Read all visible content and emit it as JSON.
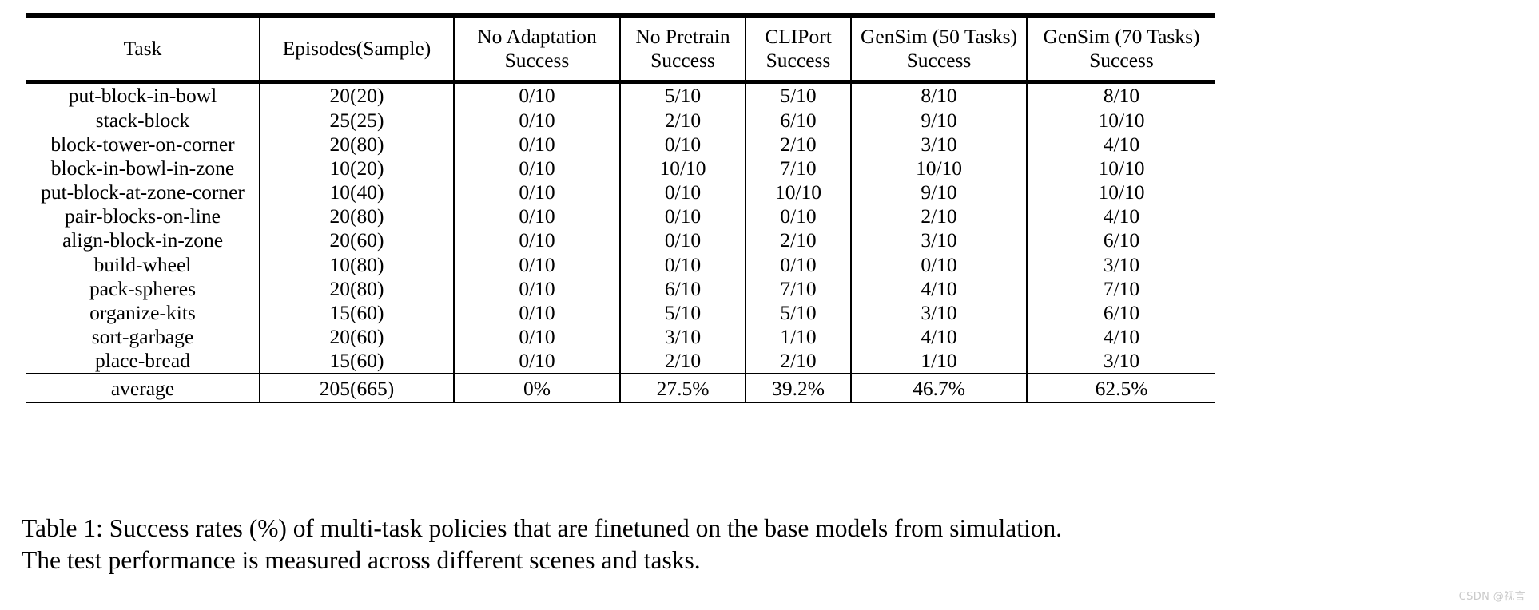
{
  "table": {
    "id": "table-1",
    "columns": [
      {
        "key": "task",
        "line1": "Task",
        "line2": ""
      },
      {
        "key": "ep",
        "line1": "Episodes(Sample)",
        "line2": ""
      },
      {
        "key": "noadapt",
        "line1": "No Adaptation",
        "line2": "Success"
      },
      {
        "key": "nopre",
        "line1": "No Pretrain",
        "line2": "Success"
      },
      {
        "key": "clip",
        "line1": "CLIPort",
        "line2": "Success"
      },
      {
        "key": "g50",
        "line1": "GenSim (50 Tasks)",
        "line2": "Success"
      },
      {
        "key": "g70",
        "line1": "GenSim (70 Tasks)",
        "line2": "Success"
      }
    ],
    "rows": [
      {
        "task": "put-block-in-bowl",
        "ep": "20(20)",
        "noadapt": "0/10",
        "nopre": "5/10",
        "clip": "5/10",
        "g50": "8/10",
        "g70": "8/10"
      },
      {
        "task": "stack-block",
        "ep": "25(25)",
        "noadapt": "0/10",
        "nopre": "2/10",
        "clip": "6/10",
        "g50": "9/10",
        "g70": "10/10"
      },
      {
        "task": "block-tower-on-corner",
        "ep": "20(80)",
        "noadapt": "0/10",
        "nopre": "0/10",
        "clip": "2/10",
        "g50": "3/10",
        "g70": "4/10"
      },
      {
        "task": "block-in-bowl-in-zone",
        "ep": "10(20)",
        "noadapt": "0/10",
        "nopre": "10/10",
        "clip": "7/10",
        "g50": "10/10",
        "g70": "10/10"
      },
      {
        "task": "put-block-at-zone-corner",
        "ep": "10(40)",
        "noadapt": "0/10",
        "nopre": "0/10",
        "clip": "10/10",
        "g50": "9/10",
        "g70": "10/10"
      },
      {
        "task": "pair-blocks-on-line",
        "ep": "20(80)",
        "noadapt": "0/10",
        "nopre": "0/10",
        "clip": "0/10",
        "g50": "2/10",
        "g70": "4/10"
      },
      {
        "task": "align-block-in-zone",
        "ep": "20(60)",
        "noadapt": "0/10",
        "nopre": "0/10",
        "clip": "2/10",
        "g50": "3/10",
        "g70": "6/10"
      },
      {
        "task": "build-wheel",
        "ep": "10(80)",
        "noadapt": "0/10",
        "nopre": "0/10",
        "clip": "0/10",
        "g50": "0/10",
        "g70": "3/10"
      },
      {
        "task": "pack-spheres",
        "ep": "20(80)",
        "noadapt": "0/10",
        "nopre": "6/10",
        "clip": "7/10",
        "g50": "4/10",
        "g70": "7/10"
      },
      {
        "task": "organize-kits",
        "ep": "15(60)",
        "noadapt": "0/10",
        "nopre": "5/10",
        "clip": "5/10",
        "g50": "3/10",
        "g70": "6/10"
      },
      {
        "task": "sort-garbage",
        "ep": "20(60)",
        "noadapt": "0/10",
        "nopre": "3/10",
        "clip": "1/10",
        "g50": "4/10",
        "g70": "4/10"
      },
      {
        "task": "place-bread",
        "ep": "15(60)",
        "noadapt": "0/10",
        "nopre": "2/10",
        "clip": "2/10",
        "g50": "1/10",
        "g70": "3/10"
      }
    ],
    "average": {
      "task": "average",
      "ep": "205(665)",
      "noadapt": "0%",
      "nopre": "27.5%",
      "clip": "39.2%",
      "g50": "46.7%",
      "g70": "62.5%"
    }
  },
  "caption": {
    "line1": "Table 1: Success rates (%) of multi-task policies that are finetuned on the base models from simulation.",
    "line2": "The test performance is measured across different scenes and tasks."
  },
  "watermark": {
    "text": "CSDN @视言",
    "color": "#c9c9c9"
  },
  "chart_data": {
    "type": "table",
    "title": "Success rates (%) of multi-task policies that are finetuned on the base models from simulation.",
    "categories": [
      "put-block-in-bowl",
      "stack-block",
      "block-tower-on-corner",
      "block-in-bowl-in-zone",
      "put-block-at-zone-corner",
      "pair-blocks-on-line",
      "align-block-in-zone",
      "build-wheel",
      "pack-spheres",
      "organize-kits",
      "sort-garbage",
      "place-bread"
    ],
    "episodes_sample": [
      "20(20)",
      "25(25)",
      "20(80)",
      "10(20)",
      "10(40)",
      "20(80)",
      "20(60)",
      "10(80)",
      "20(80)",
      "15(60)",
      "20(60)",
      "15(60)"
    ],
    "series": [
      {
        "name": "No Adaptation Success",
        "values": [
          0,
          0,
          0,
          0,
          0,
          0,
          0,
          0,
          0,
          0,
          0,
          0
        ],
        "out_of": 10,
        "average_pct": 0.0
      },
      {
        "name": "No Pretrain Success",
        "values": [
          5,
          2,
          0,
          10,
          0,
          0,
          0,
          0,
          6,
          5,
          3,
          2
        ],
        "out_of": 10,
        "average_pct": 27.5
      },
      {
        "name": "CLIPort Success",
        "values": [
          5,
          6,
          2,
          7,
          10,
          0,
          2,
          0,
          7,
          5,
          1,
          2
        ],
        "out_of": 10,
        "average_pct": 39.2
      },
      {
        "name": "GenSim (50 Tasks) Success",
        "values": [
          8,
          9,
          3,
          10,
          9,
          2,
          3,
          0,
          4,
          3,
          4,
          1
        ],
        "out_of": 10,
        "average_pct": 46.7
      },
      {
        "name": "GenSim (70 Tasks) Success",
        "values": [
          8,
          10,
          4,
          10,
          10,
          4,
          6,
          3,
          7,
          6,
          4,
          3
        ],
        "out_of": 10,
        "average_pct": 62.5
      }
    ],
    "totals": {
      "episodes": 205,
      "samples": 665
    },
    "xlabel": "Task",
    "ylabel": "Success",
    "grid": false,
    "legend": "none"
  }
}
